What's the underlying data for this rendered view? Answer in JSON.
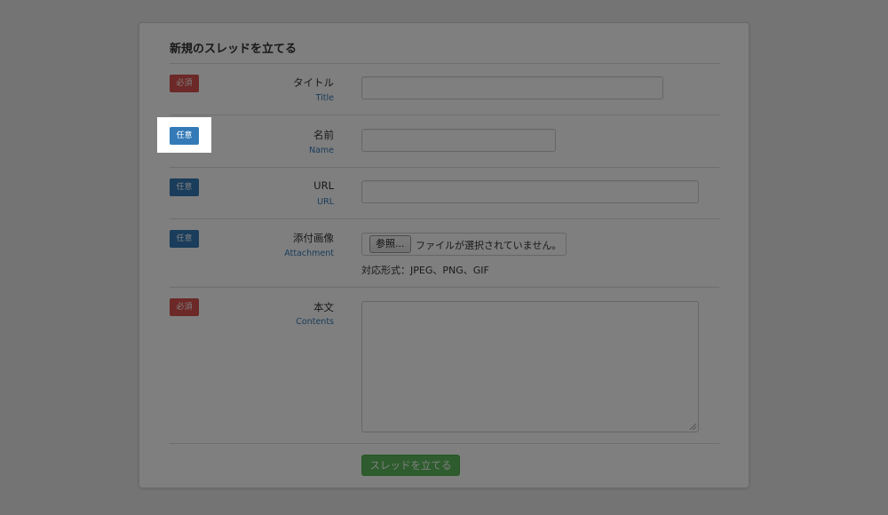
{
  "form": {
    "title": "新規のスレッドを立てる",
    "badges": {
      "required": "必須",
      "optional": "任意"
    },
    "fields": [
      {
        "label": "タイトル",
        "sublabel": "Title",
        "value": ""
      },
      {
        "label": "名前",
        "sublabel": "Name",
        "value": ""
      },
      {
        "label": "URL",
        "sublabel": "URL",
        "value": ""
      },
      {
        "label": "添付画像",
        "sublabel": "Attachment",
        "file_button": "参照...",
        "file_status": "ファイルが選択されていません。",
        "formats": "対応形式：JPEG、PNG、GIF"
      },
      {
        "label": "本文",
        "sublabel": "Contents",
        "value": ""
      }
    ],
    "submit_label": "スレッドを立てる"
  },
  "colors": {
    "required_badge": "#d9534f",
    "optional_badge": "#337ab7",
    "submit": "#5cb85c",
    "sublabel": "#337ab7"
  }
}
